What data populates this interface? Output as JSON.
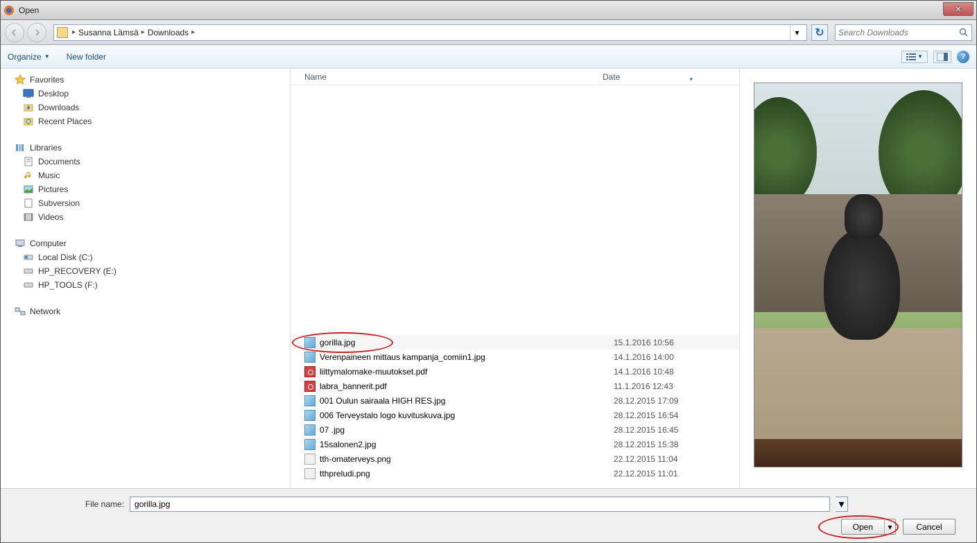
{
  "window_title": "Open",
  "breadcrumb": {
    "user": "Susanna Lämsä",
    "folder": "Downloads"
  },
  "search": {
    "placeholder": "Search Downloads"
  },
  "toolbar": {
    "organize": "Organize",
    "new_folder": "New folder"
  },
  "list_header": {
    "name": "Name",
    "date": "Date"
  },
  "sidebar": {
    "favorites": {
      "label": "Favorites",
      "items": [
        "Desktop",
        "Downloads",
        "Recent Places"
      ]
    },
    "libraries": {
      "label": "Libraries",
      "items": [
        "Documents",
        "Music",
        "Pictures",
        "Subversion",
        "Videos"
      ]
    },
    "computer": {
      "label": "Computer",
      "items": [
        "Local Disk (C:)",
        "HP_RECOVERY (E:)",
        "HP_TOOLS (F:)"
      ]
    },
    "network": {
      "label": "Network"
    }
  },
  "files": [
    {
      "name": "gorilla.jpg",
      "date": "15.1.2016 10:56",
      "type": "img",
      "selected": true
    },
    {
      "name": "Verenpaineen mittaus kampanja_comiin1.jpg",
      "date": "14.1.2016 14:00",
      "type": "img"
    },
    {
      "name": "liittymalomake-muutokset.pdf",
      "date": "14.1.2016 10:48",
      "type": "pdf"
    },
    {
      "name": "labra_bannerit.pdf",
      "date": "11.1.2016 12:43",
      "type": "pdf"
    },
    {
      "name": "001 Oulun sairaala HIGH RES.jpg",
      "date": "28.12.2015 17:09",
      "type": "img"
    },
    {
      "name": "006 Terveystalo logo kuvituskuva.jpg",
      "date": "28.12.2015 16:54",
      "type": "img"
    },
    {
      "name": "07 .jpg",
      "date": "28.12.2015 16:45",
      "type": "img"
    },
    {
      "name": "15salonen2.jpg",
      "date": "28.12.2015 15:38",
      "type": "img"
    },
    {
      "name": "tth-omaterveys.png",
      "date": "22.12.2015 11:04",
      "type": "png"
    },
    {
      "name": "tthpreludi.png",
      "date": "22.12.2015 11:01",
      "type": "png"
    }
  ],
  "filename": {
    "label": "File name:",
    "value": "gorilla.jpg"
  },
  "buttons": {
    "open": "Open",
    "cancel": "Cancel"
  }
}
